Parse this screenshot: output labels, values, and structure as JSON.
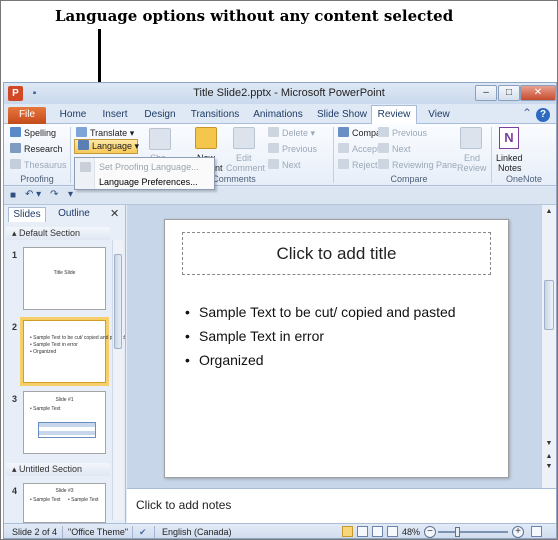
{
  "annotation": "Language options without any content selected",
  "window": {
    "title": "Title Slide2.pptx - Microsoft PowerPoint",
    "app_letter": "P",
    "minimize": "–",
    "maximize": "□",
    "close": "✕"
  },
  "ribbon_tabs": [
    "File",
    "Home",
    "Insert",
    "Design",
    "Transitions",
    "Animations",
    "Slide Show",
    "Review",
    "View"
  ],
  "active_tab": "Review",
  "ribbon": {
    "spelling": "Spelling",
    "research": "Research",
    "thesaurus": "Thesaurus",
    "proofing": "Proofing",
    "translate": "Translate",
    "language": "Language",
    "show_comments_partial": "Sho",
    "new_comment_partial": "New",
    "comment_partial": "nt",
    "edit_comment_line1": "Edit",
    "edit_comment_line2": "Comment",
    "delete": "Delete",
    "previous": "Previous",
    "next": "Next",
    "comments": "Comments",
    "compare": "Compare",
    "accept": "Accept",
    "reject": "Reject",
    "previous_change": "Previous",
    "next_change": "Next",
    "reviewing_pane": "Reviewing Pane",
    "end_review_line1": "End",
    "end_review_line2": "Review",
    "compare_group": "Compare",
    "linked_notes_line1": "Linked",
    "linked_notes_line2": "Notes",
    "onenote": "OneNote",
    "onenote_letter": "N"
  },
  "language_menu": {
    "set_proofing": "Set Proofing Language...",
    "preferences": "Language Preferences..."
  },
  "pane_tabs": {
    "slides": "Slides",
    "outline": "Outline",
    "close": "✕"
  },
  "sections": [
    "Default Section",
    "Untitled Section"
  ],
  "thumbnails": [
    {
      "num": "1",
      "title": "Title Slide"
    },
    {
      "num": "2",
      "lines": [
        "• Sample Text to be cut/ copied and pasted",
        "• Sample Text in error",
        "• Organized"
      ]
    },
    {
      "num": "3",
      "title": "Slide #1",
      "lines": [
        "• Sample Text"
      ]
    },
    {
      "num": "4",
      "title": "Slide #3",
      "lines": [
        "• Sample Text",
        "• Sample Text"
      ]
    }
  ],
  "slide": {
    "title_placeholder": "Click to add title",
    "bullets": [
      "Sample Text to be cut/ copied and pasted",
      "Sample Text in error",
      "Organized"
    ]
  },
  "notes_placeholder": "Click to add notes",
  "status": {
    "slide_info": "Slide 2 of 4",
    "theme": "\"Office Theme\"",
    "language": "English (Canada)",
    "zoom": "48%"
  }
}
